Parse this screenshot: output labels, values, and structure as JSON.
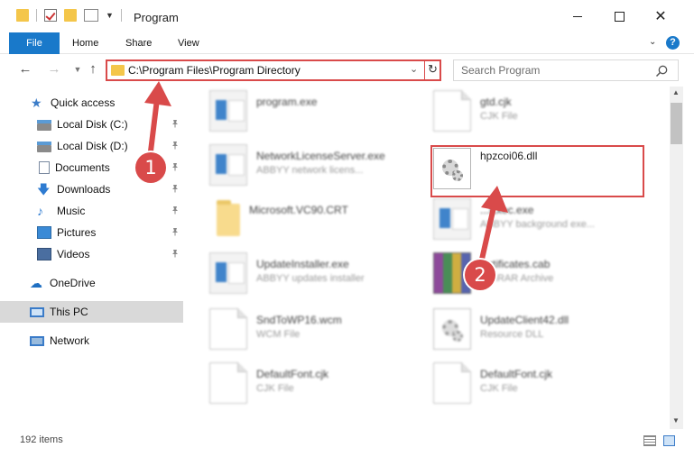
{
  "window": {
    "title": "Program",
    "controls": {
      "minimize": "Minimize",
      "maximize": "Maximize",
      "close": "✕"
    }
  },
  "ribbon": {
    "tabs": [
      {
        "label": "File",
        "active": true
      },
      {
        "label": "Home"
      },
      {
        "label": "Share"
      },
      {
        "label": "View"
      }
    ],
    "help": "?"
  },
  "navigation": {
    "address": "C:\\Program Files\\Program Directory",
    "search_placeholder": "Search Program"
  },
  "sidebar": {
    "items": [
      {
        "label": "Quick access",
        "icon": "star-icon"
      },
      {
        "label": "Local Disk (C:)",
        "icon": "disk-icon",
        "pinned": true
      },
      {
        "label": "Local Disk (D:)",
        "icon": "disk-icon",
        "pinned": true
      },
      {
        "label": "Documents",
        "icon": "document-icon",
        "pinned": true
      },
      {
        "label": "Downloads",
        "icon": "download-icon",
        "pinned": true
      },
      {
        "label": "Music",
        "icon": "music-icon",
        "pinned": true
      },
      {
        "label": "Pictures",
        "icon": "picture-icon",
        "pinned": true
      },
      {
        "label": "Videos",
        "icon": "video-icon",
        "pinned": true
      },
      {
        "label": "OneDrive",
        "icon": "cloud-icon"
      },
      {
        "label": "This PC",
        "icon": "computer-icon",
        "selected": true
      },
      {
        "label": "Network",
        "icon": "network-icon"
      }
    ]
  },
  "files": [
    {
      "name": "program.exe",
      "type": "",
      "icon": "app-icon"
    },
    {
      "name": "gtd.cjk",
      "type": "CJK File",
      "icon": "page-icon"
    },
    {
      "name": "NetworkLicenseServer.exe",
      "type": "ABBYY network licens...",
      "icon": "app-icon"
    },
    {
      "name": "hpzcoi06.dll",
      "type": "",
      "icon": "dll-gear-icon",
      "highlighted": true
    },
    {
      "name": "Microsoft.VC90.CRT",
      "type": "",
      "icon": "folder-icon"
    },
    {
      "name": "...Exec.exe",
      "type": "ABBYY background exe...",
      "icon": "app-icon"
    },
    {
      "name": "UpdateInstaller.exe",
      "type": "ABBYY updates installer",
      "icon": "app-icon"
    },
    {
      "name": "...rtificates.cab",
      "type": "WinRAR Archive",
      "icon": "archive-icon"
    },
    {
      "name": "SndToWP16.wcm",
      "type": "WCM File",
      "icon": "page-icon"
    },
    {
      "name": "UpdateClient42.dll",
      "type": "Resource DLL",
      "icon": "dll-gear-icon"
    },
    {
      "name": "DefaultFont.cjk",
      "type": "CJK File",
      "icon": "page-icon"
    },
    {
      "name": "DefaultFont.cjk",
      "type": "CJK File",
      "icon": "page-icon"
    }
  ],
  "status": {
    "item_count": "192 items"
  },
  "annotations": {
    "callout_1": "1",
    "callout_2": "2",
    "accent_color": "#d94a4a"
  }
}
